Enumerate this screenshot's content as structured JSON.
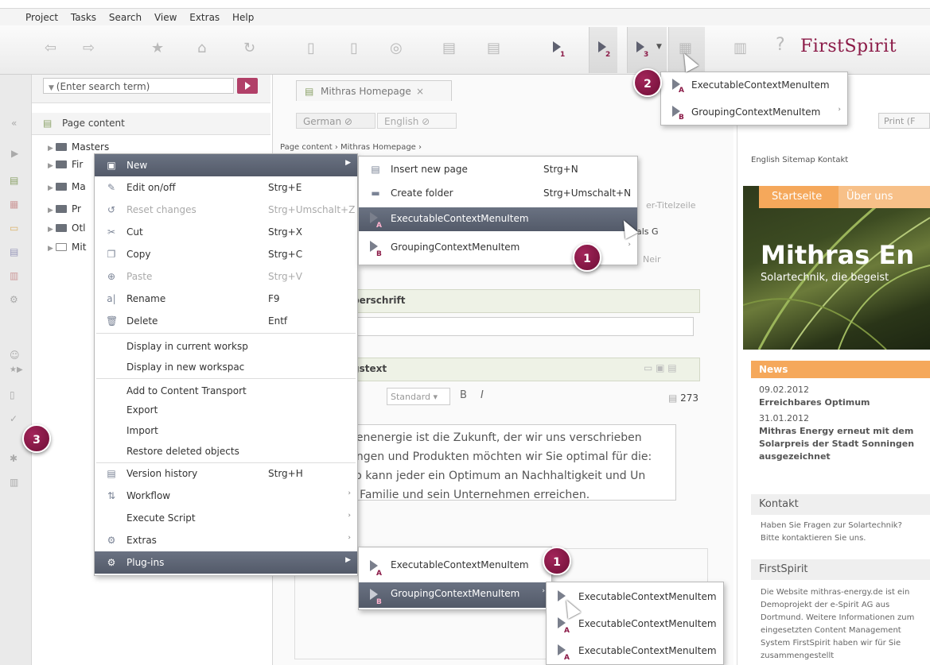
{
  "menubar": [
    "Project",
    "Tasks",
    "Search",
    "View",
    "Extras",
    "Help"
  ],
  "toolbar": {
    "logo": "FirstSpirit",
    "help": "?",
    "exec_numbers": [
      "1",
      "2",
      "3"
    ]
  },
  "search": {
    "placeholder": "(Enter search term)"
  },
  "tree": {
    "header": "Page content",
    "items": [
      {
        "label": "Masters"
      },
      {
        "label": "Fir"
      },
      {
        "label": "Ma"
      },
      {
        "label": "Pr"
      },
      {
        "label": "Otl"
      },
      {
        "label": "Mit"
      }
    ]
  },
  "center": {
    "tab_title": "Mithras Homepage",
    "tab_close": "×",
    "lang_german": "German",
    "lang_english": "English",
    "breadcrumb": "Page content  ›  Mithras Homepage  ›",
    "subtitle_tab": "er-Titelzeile",
    "als_g": "als G",
    "neir": "Neir",
    "section_ueberschrift": "berschrift",
    "section_text": "gstext",
    "rte_style": "Standard",
    "bold": "B",
    "italic": "I",
    "char_count": "273",
    "rte_lines": [
      "nenenergie ist die Zukunft, der wir uns verschrieben",
      "ungen und Produkten möchten wir Sie optimal für die:",
      "so kann jeder ein Optimum an Nachhaltigkeit und Un",
      "e Familie und sein Unternehmen erreichen."
    ]
  },
  "preview": {
    "nav": "English   Sitemap   Kontakt",
    "print": "Print (F",
    "tab_start": "Startseite",
    "tab_ueber": "Über uns",
    "hero_title": "Mithras En",
    "hero_sub": "Solartechnik, die begeist",
    "news": "News",
    "news_lines": [
      "09.02.2012",
      "Erreichbares Optimum",
      "31.01.2012",
      "Mithras Energy erneut mit dem",
      "Solarpreis der Stadt Sonningen",
      "ausgezeichnet"
    ],
    "kontakt": "Kontakt",
    "kontakt_lines": [
      "Haben Sie Fragen zur Solartechnik?",
      "Bitte kontaktieren Sie uns."
    ],
    "firstspirit": "FirstSpirit",
    "fs_lines": [
      "Die Website mithras-energy.de ist ein",
      "Demoprojekt der e-Spirit AG aus",
      "Dortmund. Weitere Informationen zum",
      "eingesetzten Content Management",
      "System FirstSpirit haben wir für Sie",
      "zusammengestellt"
    ]
  },
  "context_menu": {
    "items": [
      {
        "label": "New",
        "icon": "new-icon"
      },
      {
        "label": "Edit on/off",
        "shortcut": "Strg+E"
      },
      {
        "label": "Reset changes",
        "shortcut": "Strg+Umschalt+Z",
        "disabled": true
      },
      {
        "label": "Cut",
        "shortcut": "Strg+X"
      },
      {
        "label": "Copy",
        "shortcut": "Strg+C"
      },
      {
        "label": "Paste",
        "shortcut": "Strg+V",
        "disabled": true
      },
      {
        "label": "Rename",
        "shortcut": "F9"
      },
      {
        "label": "Delete",
        "shortcut": "Entf"
      },
      {
        "label": "Display in current worksp"
      },
      {
        "label": "Display in new workspac"
      },
      {
        "label": "Add to Content Transport"
      },
      {
        "label": "Export"
      },
      {
        "label": "Import"
      },
      {
        "label": "Restore deleted objects"
      },
      {
        "label": "Version history",
        "shortcut": "Strg+H"
      },
      {
        "label": "Workflow"
      },
      {
        "label": "Execute Script"
      },
      {
        "label": "Extras"
      },
      {
        "label": "Plug-ins"
      }
    ]
  },
  "new_submenu": {
    "items": [
      {
        "label": "Insert new page",
        "shortcut": "Strg+N"
      },
      {
        "label": "Create folder",
        "shortcut": "Strg+Umschalt+N"
      },
      {
        "label": "ExecutableContextMenuItem",
        "letter": "A"
      },
      {
        "label": "GroupingContextMenuItem",
        "letter": "B"
      }
    ]
  },
  "toolbar_dropdown": {
    "items": [
      {
        "label": "ExecutableContextMenuItem",
        "letter": "A"
      },
      {
        "label": "GroupingContextMenuItem",
        "letter": "B"
      }
    ]
  },
  "plugins_submenu": {
    "items": [
      {
        "label": "ExecutableContextMenuItem",
        "letter": "A"
      },
      {
        "label": "GroupingContextMenuItem",
        "letter": "B"
      }
    ]
  },
  "grouping_submenu": {
    "items": [
      {
        "label": "ExecutableContextMenuItem"
      },
      {
        "label": "ExecutableContextMenuItem",
        "letter": "A"
      },
      {
        "label": "ExecutableContextMenuItem",
        "letter": "A"
      }
    ]
  },
  "badges": [
    "1",
    "2",
    "3",
    "1"
  ],
  "colors": {
    "brand": "#8b1a47",
    "menu_highlight": "#5f6676",
    "accent_orange": "#f5a85b"
  }
}
